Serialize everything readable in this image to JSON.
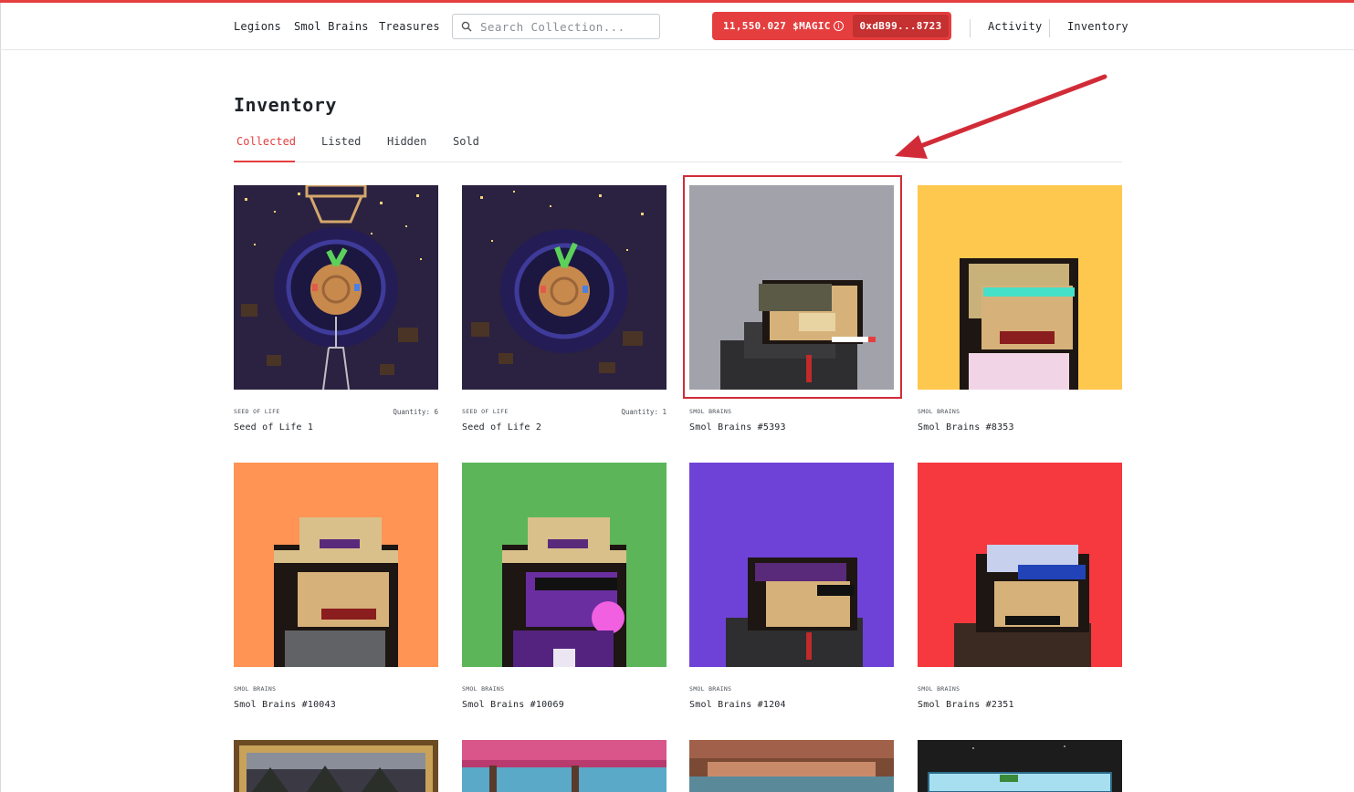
{
  "header": {
    "nav": [
      "Legions",
      "Smol Brains",
      "Treasures"
    ],
    "search_placeholder": "Search Collection...",
    "balance": "11,550.027 $MAGIC",
    "address": "0xdB99...8723",
    "right_links": [
      "Activity",
      "Inventory"
    ]
  },
  "page": {
    "title": "Inventory",
    "tabs": [
      "Collected",
      "Listed",
      "Hidden",
      "Sold"
    ],
    "active_tab": "Collected"
  },
  "items": [
    {
      "collection": "SEED OF LIFE",
      "name": "Seed of Life 1",
      "quantity": "Quantity: 6",
      "bg": "#2b2140"
    },
    {
      "collection": "SEED OF LIFE",
      "name": "Seed of Life 2",
      "quantity": "Quantity: 1",
      "bg": "#2b2140"
    },
    {
      "collection": "SMOL BRAINS",
      "name": "Smol Brains #5393",
      "quantity": "",
      "bg": "#a2a2ab"
    },
    {
      "collection": "SMOL BRAINS",
      "name": "Smol Brains #8353",
      "quantity": "",
      "bg": "#fec84f"
    },
    {
      "collection": "SMOL BRAINS",
      "name": "Smol Brains #10043",
      "quantity": "",
      "bg": "#ff9455"
    },
    {
      "collection": "SMOL BRAINS",
      "name": "Smol Brains #10069",
      "quantity": "",
      "bg": "#5db55a"
    },
    {
      "collection": "SMOL BRAINS",
      "name": "Smol Brains #1204",
      "quantity": "",
      "bg": "#6f42d7"
    },
    {
      "collection": "SMOL BRAINS",
      "name": "Smol Brains #2351",
      "quantity": "",
      "bg": "#f5393f"
    }
  ],
  "colors": {
    "accent": "#e53e3e"
  }
}
